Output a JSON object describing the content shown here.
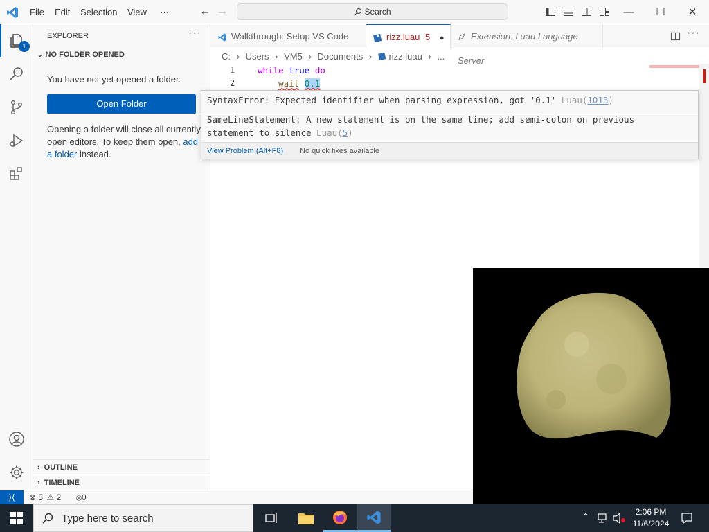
{
  "titlebar": {
    "menu": [
      "File",
      "Edit",
      "Selection",
      "View",
      "···"
    ],
    "search_placeholder": "Search"
  },
  "activity_bar": {
    "explorer_badge": "1"
  },
  "sidebar": {
    "title": "EXPLORER",
    "more": "···",
    "section": "NO FOLDER OPENED",
    "message": "You have not yet opened a folder.",
    "open_folder_label": "Open Folder",
    "hint_prefix": "Opening a folder will close all currently open editors. To keep them open, ",
    "hint_link": "add a folder",
    "hint_suffix": " instead.",
    "outline_label": "OUTLINE",
    "timeline_label": "TIMELINE"
  },
  "tabs": [
    {
      "label": "Walkthrough: Setup VS Code",
      "icon": "vscode-icon"
    },
    {
      "label": "rizz.luau",
      "problems": "5",
      "dirty": "●",
      "icon": "luau-file-icon"
    },
    {
      "label": "Extension: Luau Language Server",
      "icon": "extension-icon"
    }
  ],
  "breadcrumb": [
    "C:",
    "Users",
    "VM5",
    "Documents",
    "rizz.luau",
    "..."
  ],
  "editor": {
    "line_numbers": [
      "1",
      "2"
    ],
    "line1": {
      "kw1": "while",
      "kw2": "true",
      "kw3": "do"
    },
    "line2": {
      "fn": "wait",
      "arg": "0.1"
    }
  },
  "hover": {
    "problem1_text": "SyntaxError: Expected identifier when parsing expression, got '0.1'",
    "problem1_source": "Luau(",
    "problem1_code": "1013",
    "problem2_text_line1": "SameLineStatement: A new statement is on the same line; add semi-colon on previous",
    "problem2_text_line2": "statement to silence",
    "problem2_source": "Luau(",
    "problem2_code": "5",
    "view_problem": "View Problem (Alt+F8)",
    "no_fixes": "No quick fixes available"
  },
  "statusbar": {
    "errors": "3",
    "warnings": "2",
    "ports": "0"
  },
  "taskbar": {
    "search_placeholder": "Type here to search",
    "time": "2:06 PM",
    "date": "11/6/2024"
  },
  "colors": {
    "accent": "#005fb8",
    "error": "#e51400",
    "keyword": "#af00db"
  }
}
